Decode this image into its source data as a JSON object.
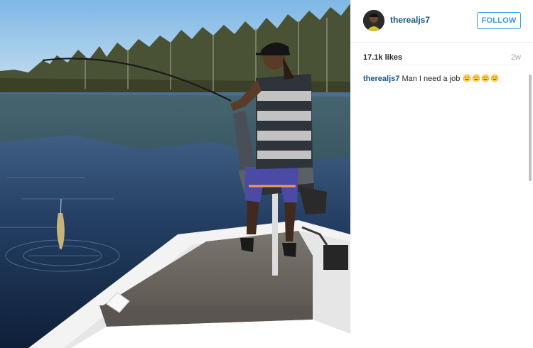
{
  "post": {
    "username": "therealjs7",
    "follow_label": "FOLLOW",
    "likes": "17.1k likes",
    "time": "2w",
    "caption_user": "therealjs7",
    "caption_text": "Man I need a job",
    "caption_emojis": [
      "tears-of-joy-emoji",
      "tears-of-joy-emoji",
      "tears-of-joy-emoji",
      "tears-of-joy-emoji"
    ]
  },
  "colors": {
    "username": "#125688",
    "follow": "#3897f0",
    "muted": "#a5a7aa",
    "emoji": "#ffcc4d"
  }
}
